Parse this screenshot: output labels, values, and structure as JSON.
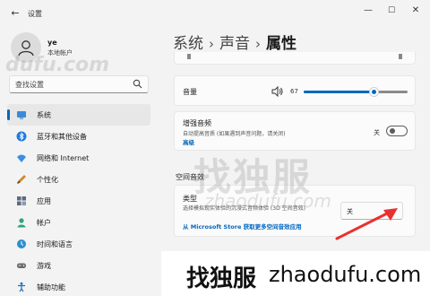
{
  "window": {
    "title": "设置",
    "back_glyph": "←",
    "min_glyph": "—",
    "max_glyph": "☐",
    "close_glyph": "✕"
  },
  "profile": {
    "name": "ye",
    "account_type": "本地帐户"
  },
  "search": {
    "placeholder": "查找设置"
  },
  "sidebar": {
    "items": [
      {
        "label": "系统",
        "icon": "monitor-icon",
        "active": true
      },
      {
        "label": "蓝牙和其他设备",
        "icon": "bluetooth-icon",
        "active": false
      },
      {
        "label": "网络和 Internet",
        "icon": "wifi-icon",
        "active": false
      },
      {
        "label": "个性化",
        "icon": "brush-icon",
        "active": false
      },
      {
        "label": "应用",
        "icon": "apps-icon",
        "active": false
      },
      {
        "label": "帐户",
        "icon": "person-icon",
        "active": false
      },
      {
        "label": "时间和语言",
        "icon": "globe-clock-icon",
        "active": false
      },
      {
        "label": "游戏",
        "icon": "gamepad-icon",
        "active": false
      },
      {
        "label": "辅助功能",
        "icon": "accessibility-icon",
        "active": false
      }
    ]
  },
  "breadcrumb": {
    "items": [
      "系统",
      "声音",
      "属性"
    ],
    "separator": "›"
  },
  "volume": {
    "label": "音量",
    "value": "67",
    "level": 0.67
  },
  "enhance": {
    "title": "增强音频",
    "description": "自动提高音质 (如果遇到声音问题，请关闭)",
    "link": "高级",
    "state": "关"
  },
  "spatial": {
    "section_title": "空间音效",
    "type_label": "类型",
    "type_description": "选择模拟现实体验的沉浸式音频体验 (3D 空间音效)",
    "store_link": "从 Microsoft Store 获取更多空间音效应用",
    "selected": "关"
  },
  "watermarks": {
    "center_cn": "找独服",
    "center_en": "zhaodufu.com",
    "left_en": "dufu.com",
    "bar_cn": "找独服",
    "bar_en": "zhaodufu.com"
  },
  "colors": {
    "accent": "#0067c0",
    "annotation_arrow": "#e8312f"
  }
}
